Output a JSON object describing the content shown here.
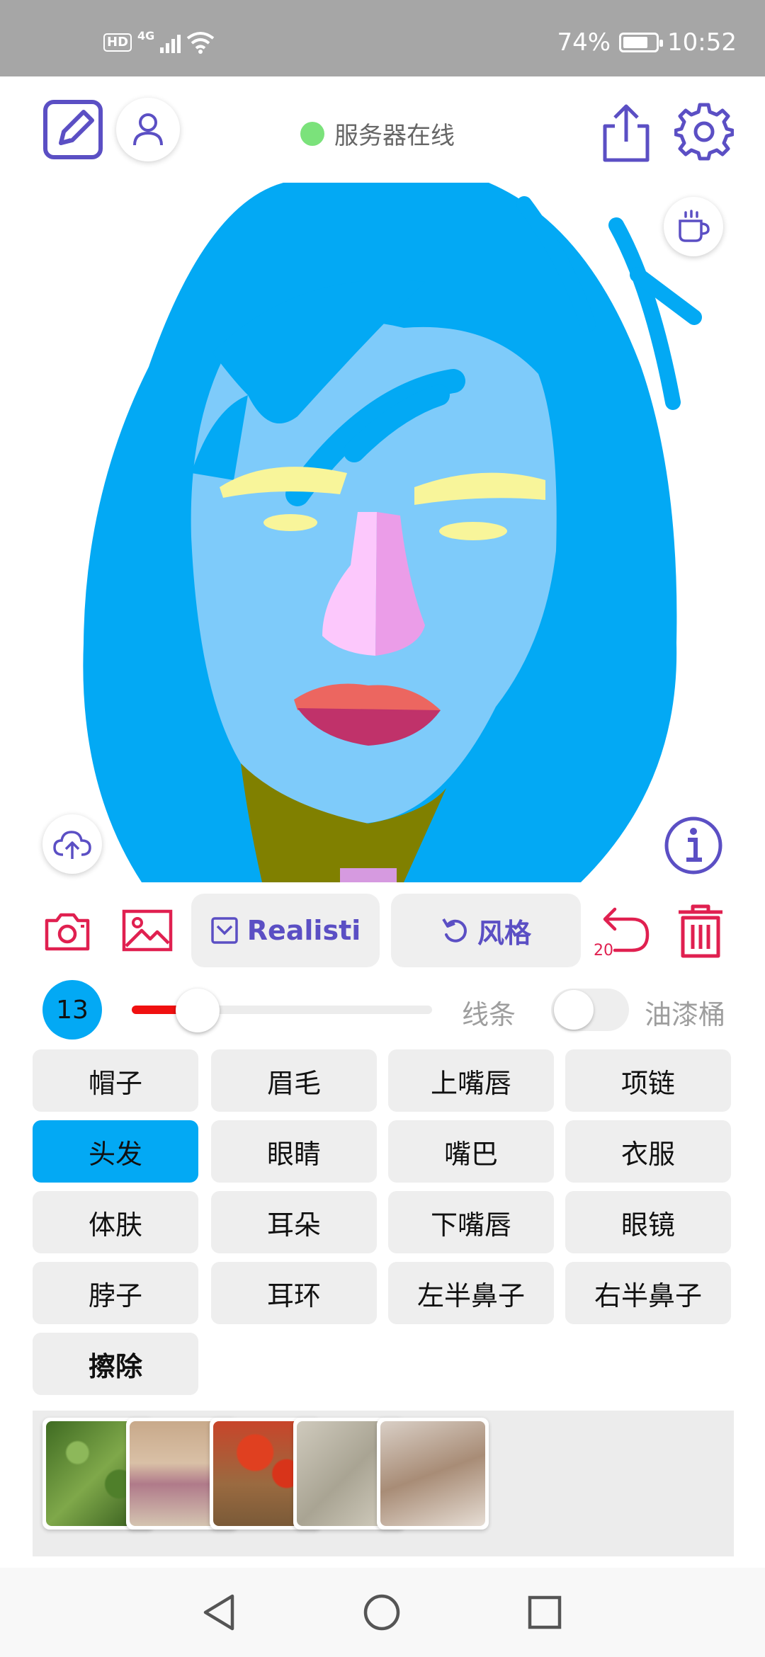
{
  "status_bar": {
    "hd": "HD",
    "network": "4G",
    "battery_percent": "74%",
    "time": "10:52",
    "battery_level": 0.74
  },
  "top_bar": {
    "server_status": "服务器在线",
    "server_status_color": "#7be27b"
  },
  "tools": {
    "model_label": "Realisti",
    "style_label": "风格",
    "undo_count": "20"
  },
  "brush": {
    "size": "13",
    "size_level": 0.22,
    "line_label": "线条",
    "bucket_label": "油漆桶",
    "bucket_enabled": false
  },
  "parts": [
    "帽子",
    "眉毛",
    "上嘴唇",
    "项链",
    "头发",
    "眼睛",
    "嘴巴",
    "衣服",
    "体肤",
    "耳朵",
    "下嘴唇",
    "眼镜",
    "脖子",
    "耳环",
    "左半鼻子",
    "右半鼻子",
    "擦除"
  ],
  "selected_part": "头发",
  "style_thumbnails": [
    "green-foliage-style",
    "painted-texture-style",
    "red-flowers-style",
    "grey-texture-style",
    "sepia-photo-style"
  ],
  "colors": {
    "accent": "#5b4fc4",
    "danger": "#e02050",
    "selected": "#03a9f4"
  }
}
